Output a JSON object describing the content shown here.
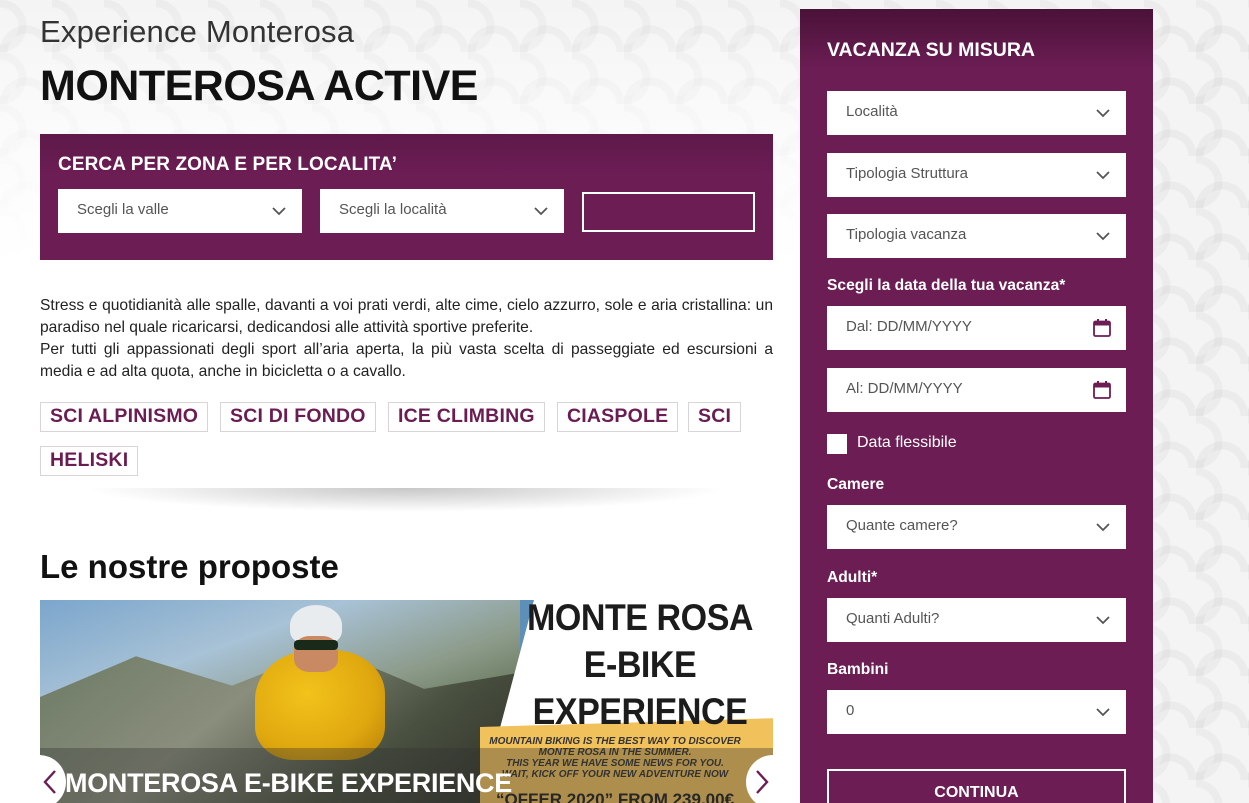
{
  "header": {
    "subtitle": "Experience Monterosa",
    "title": "MONTEROSA ACTIVE"
  },
  "search": {
    "title": "CERCA PER ZONA E PER LOCALITA’",
    "valle_placeholder": "Scegli la valle",
    "localita_placeholder": "Scegli la località",
    "submit_label": ""
  },
  "description": {
    "line1": "Stress e quotidianità alle spalle, davanti a voi prati verdi, alte cime, cielo azzurro, sole e aria cristallina: un paradiso nel quale ricaricarsi, dedicandosi alle attività sportive preferite.",
    "line2": "Per tutti gli appassionati degli sport all’aria aperta, la più vasta scelta di passeggiate ed escursioni a media e ad alta quota, anche in bicicletta o a cavallo."
  },
  "tags": [
    "SCI ALPINISMO",
    "SCI DI FONDO",
    "ICE CLIMBING",
    "CIASPOLE",
    "SCI",
    "HELISKI"
  ],
  "proposals": {
    "title": "Le nostre proposte",
    "slide": {
      "headline_1": "MONTE ROSA",
      "headline_2": "E-BIKE",
      "headline_3": "EXPERIENCE",
      "tagline_1": "MOUNTAIN BIKING IS THE BEST WAY TO DISCOVER",
      "tagline_2": "MONTE ROSA IN THE SUMMER.",
      "tagline_3": "THIS YEAR WE HAVE SOME NEWS FOR YOU.",
      "tagline_4": "WAIT, KICK OFF YOUR NEW ADVENTURE NOW",
      "offer": "“OFFER 2020” FROM 239,00€",
      "caption": "MONTEROSA E-BIKE EXPERIENCE"
    }
  },
  "booking": {
    "title": "VACANZA SU MISURA",
    "localita": "Località",
    "tipologia_struttura": "Tipologia Struttura",
    "tipologia_vacanza": "Tipologia vacanza",
    "date_label": "Scegli la data della tua vacanza*",
    "date_from": "Dal: DD/MM/YYYY",
    "date_to": "Al: DD/MM/YYYY",
    "flexible_label": "Data flessibile",
    "camere_label": "Camere",
    "camere_value": "Quante camere?",
    "adulti_label": "Adulti*",
    "adulti_value": "Quanti Adulti?",
    "bambini_label": "Bambini",
    "bambini_value": "0",
    "continue_label": "CONTINUA"
  },
  "colors": {
    "brand_purple": "#6c1d54",
    "white": "#ffffff"
  }
}
